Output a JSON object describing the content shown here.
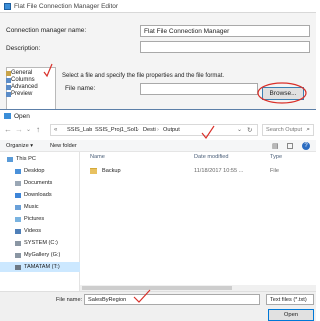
{
  "editor": {
    "title": "Flat File Connection Manager Editor",
    "connection_manager_name_label": "Connection manager name:",
    "connection_manager_name_value": "Flat File Connection Manager",
    "description_label": "Description:",
    "description_value": "",
    "sidebar": [
      "General",
      "Columns",
      "Advanced",
      "Preview"
    ],
    "instruction": "Select a file and specify the file properties and the file format.",
    "file_name_label": "File name:",
    "file_name_value": "",
    "browse_label": "Browse..."
  },
  "open_dialog": {
    "title": "Open",
    "path_segments": [
      "SSIS_Lab",
      "SSIS_Proj1_Sol1",
      "Desti",
      "Output"
    ],
    "search_placeholder": "Search Output",
    "organize_label": "Organize ▾",
    "new_folder_label": "New folder",
    "columns": [
      "Name",
      "Date modified",
      "Type"
    ],
    "files": [
      {
        "name": "Backup",
        "date": "11/18/2017 10:55 ...",
        "type": "File"
      }
    ],
    "tree": [
      {
        "label": "This PC",
        "icon": "pc-icon"
      },
      {
        "label": "Desktop",
        "icon": "desktop-icon"
      },
      {
        "label": "Documents",
        "icon": "documents-icon"
      },
      {
        "label": "Downloads",
        "icon": "downloads-icon"
      },
      {
        "label": "Music",
        "icon": "music-icon"
      },
      {
        "label": "Pictures",
        "icon": "pictures-icon"
      },
      {
        "label": "Videos",
        "icon": "videos-icon"
      },
      {
        "label": "SYSTEM (C:)",
        "icon": "drive-icon"
      },
      {
        "label": "MyGallery (G:)",
        "icon": "drive-icon"
      },
      {
        "label": "TAMATAM (T:)",
        "icon": "drive-icon"
      }
    ],
    "file_name_label": "File name:",
    "file_name_value": "SalesByRegion",
    "file_type": "Text files (*.txt)",
    "open_label": "Open"
  },
  "colors": {
    "accent": "#0078d7",
    "annotation": "#d9302a",
    "folder": "#e8c160"
  }
}
